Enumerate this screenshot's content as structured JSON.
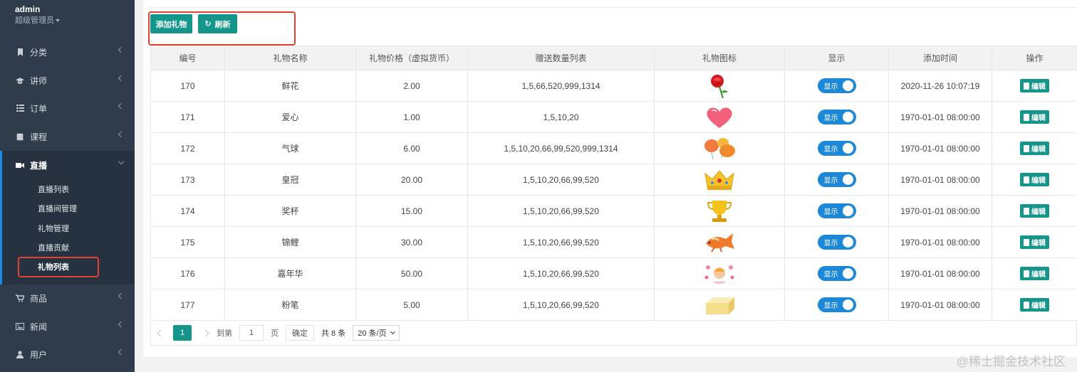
{
  "sidebar": {
    "user_name": "admin",
    "user_role": "超级管理员",
    "menu": [
      {
        "label": "分类",
        "icon": "bookmark-icon"
      },
      {
        "label": "讲师",
        "icon": "graduation-cap-icon"
      },
      {
        "label": "订单",
        "icon": "list-icon"
      },
      {
        "label": "课程",
        "icon": "book-icon"
      },
      {
        "label": "直播",
        "icon": "video-camera-icon"
      },
      {
        "label": "商品",
        "icon": "cart-icon"
      },
      {
        "label": "新闻",
        "icon": "image-icon"
      },
      {
        "label": "用户",
        "icon": "user-icon"
      }
    ],
    "submenu": [
      "直播列表",
      "直播间管理",
      "礼物管理",
      "直播贡献",
      "礼物列表"
    ]
  },
  "toolbar": {
    "add_label": "添加礼物",
    "refresh_label": "刷新"
  },
  "table": {
    "columns": [
      "编号",
      "礼物名称",
      "礼物价格（虚拟货币）",
      "赠送数量列表",
      "礼物图标",
      "显示",
      "添加时间",
      "操作"
    ],
    "toggle_label": "显示",
    "edit_label": "编辑",
    "rows": [
      {
        "id": "170",
        "name": "鲜花",
        "price": "2.00",
        "quantities": "1,5,66,520,999,1314",
        "icon": "rose-icon",
        "time": "2020-11-26 10:07:19"
      },
      {
        "id": "171",
        "name": "爱心",
        "price": "1.00",
        "quantities": "1,5,10,20",
        "icon": "heart-icon",
        "time": "1970-01-01 08:00:00"
      },
      {
        "id": "172",
        "name": "气球",
        "price": "6.00",
        "quantities": "1,5,10,20,66,99,520,999,1314",
        "icon": "balloon-icon",
        "time": "1970-01-01 08:00:00"
      },
      {
        "id": "173",
        "name": "皇冠",
        "price": "20.00",
        "quantities": "1,5,10,20,66,99,520",
        "icon": "crown-icon",
        "time": "1970-01-01 08:00:00"
      },
      {
        "id": "174",
        "name": "奖杯",
        "price": "15.00",
        "quantities": "1,5,10,20,66,99,520",
        "icon": "trophy-icon",
        "time": "1970-01-01 08:00:00"
      },
      {
        "id": "175",
        "name": "锦鲤",
        "price": "30.00",
        "quantities": "1,5,10,20,66,99,520",
        "icon": "koi-fish-icon",
        "time": "1970-01-01 08:00:00"
      },
      {
        "id": "176",
        "name": "嘉年华",
        "price": "50.00",
        "quantities": "1,5,10,20,66,99,520",
        "icon": "carnival-icon",
        "time": "1970-01-01 08:00:00"
      },
      {
        "id": "177",
        "name": "粉笔",
        "price": "5.00",
        "quantities": "1,5,10,20,66,99,520",
        "icon": "chalk-box-icon",
        "time": "1970-01-01 08:00:00"
      }
    ]
  },
  "pager": {
    "current_page": "1",
    "goto_label": "到第",
    "goto_value": "1",
    "page_unit": "页",
    "confirm_label": "确定",
    "total_label": "共 8 条",
    "page_size": "20 条/页"
  },
  "watermark": "@稀土掘金技术社区",
  "colors": {
    "sidebar_bg": "#2f3c4b",
    "accent": "#14968a",
    "toggle_on": "#1e88d8",
    "highlight": "#e4402f"
  }
}
